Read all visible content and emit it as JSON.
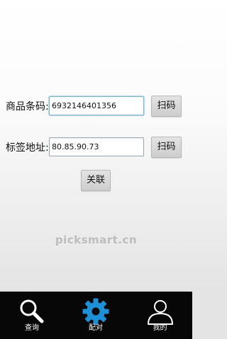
{
  "form": {
    "barcode": {
      "label": "商品条码:",
      "value": "6932146401356",
      "scan_label": "扫码"
    },
    "tag_address": {
      "label": "标签地址:",
      "value": "80.85.90.73",
      "scan_label": "扫码"
    },
    "link_label": "关联"
  },
  "watermark": "picksmart.cn",
  "bottom_nav": {
    "active_index": 1,
    "active_color": "#1e90d6",
    "tabs": [
      {
        "label": "查询",
        "icon": "search-icon"
      },
      {
        "label": "配对",
        "icon": "gear-icon"
      },
      {
        "label": "我的",
        "icon": "user-icon"
      }
    ]
  }
}
